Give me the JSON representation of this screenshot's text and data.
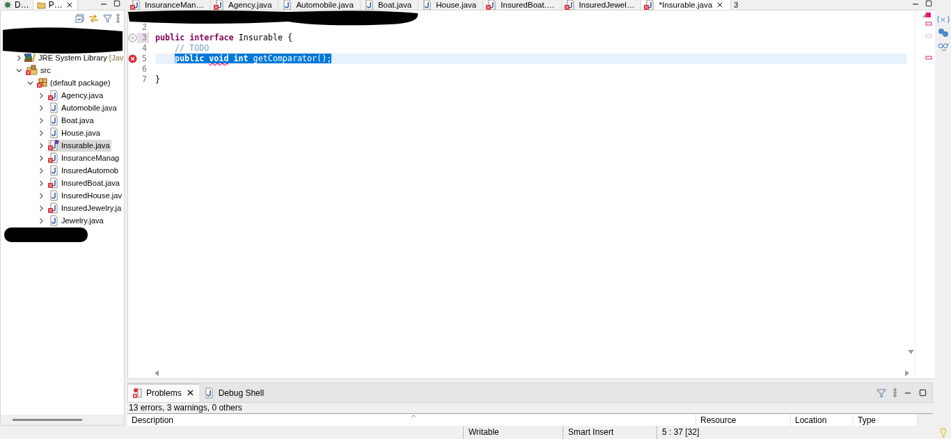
{
  "left_panel": {
    "tabs": [
      {
        "label": "D…",
        "kind": "debug",
        "selected": false
      },
      {
        "label": "P…",
        "kind": "package",
        "selected": true,
        "closable": true
      }
    ],
    "tree": [
      {
        "label": "JRE System Library",
        "suffix": "[Jav",
        "kind": "library",
        "expanded": false,
        "selected": false
      },
      {
        "label": "src",
        "kind": "folder",
        "expanded": true,
        "error": true,
        "selected": false,
        "children": [
          {
            "label": "(default package)",
            "kind": "package",
            "expanded": true,
            "error": true,
            "selected": false,
            "children": [
              {
                "label": "Agency.java",
                "kind": "class",
                "expanded": false,
                "error": true,
                "selected": false
              },
              {
                "label": "Automobile.java",
                "kind": "class",
                "expanded": false,
                "error": false,
                "selected": false
              },
              {
                "label": "Boat.java",
                "kind": "class",
                "expanded": false,
                "error": false,
                "selected": false
              },
              {
                "label": "House.java",
                "kind": "class",
                "expanded": false,
                "error": false,
                "selected": false
              },
              {
                "label": "Insurable.java",
                "kind": "interface",
                "expanded": false,
                "error": true,
                "selected": true
              },
              {
                "label": "InsuranceManag",
                "kind": "class",
                "expanded": false,
                "error": true,
                "selected": false
              },
              {
                "label": "InsuredAutomob",
                "kind": "class",
                "expanded": false,
                "error": false,
                "selected": false
              },
              {
                "label": "InsuredBoat.java",
                "kind": "class",
                "expanded": false,
                "error": true,
                "selected": false
              },
              {
                "label": "InsuredHouse.jav",
                "kind": "class",
                "expanded": false,
                "error": false,
                "selected": false
              },
              {
                "label": "InsuredJewelry.ja",
                "kind": "class",
                "expanded": false,
                "error": true,
                "selected": false
              },
              {
                "label": "Jewelry.java",
                "kind": "class",
                "expanded": false,
                "error": false,
                "selected": false
              }
            ]
          }
        ]
      }
    ]
  },
  "editor": {
    "tabs": [
      {
        "label": "InsuranceMan…",
        "error": true,
        "selected": false
      },
      {
        "label": "Agency.java",
        "error": true,
        "selected": false
      },
      {
        "label": "Automobile.java",
        "error": false,
        "selected": false
      },
      {
        "label": "Boat.java",
        "error": false,
        "selected": false
      },
      {
        "label": "House.java",
        "error": false,
        "selected": false
      },
      {
        "label": "InsuredBoat.…",
        "error": true,
        "selected": false
      },
      {
        "label": "InsuredJewel…",
        "error": true,
        "selected": false
      },
      {
        "label": "*Insurable.java",
        "error": true,
        "selected": true
      }
    ],
    "overflow_count": "3",
    "lines": [
      {
        "number": "2",
        "error_marker": false,
        "ignored_marker": false,
        "current": false,
        "changed": false
      },
      {
        "number": "3",
        "error_marker": false,
        "ignored_marker": true,
        "current": false,
        "changed": true,
        "indented": false,
        "selected": false,
        "tokens": [
          {
            "text": "public interface",
            "kind": "keyword"
          },
          {
            "text": " Insurable {",
            "kind": "plain"
          }
        ]
      },
      {
        "number": "4",
        "error_marker": false,
        "ignored_marker": false,
        "current": false,
        "changed": false,
        "indented": true,
        "selected": false,
        "tokens": [
          {
            "text": "// TODO",
            "kind": "comment"
          }
        ]
      },
      {
        "number": "5",
        "error_marker": true,
        "current": true,
        "changed": false,
        "indented": true,
        "selected": true,
        "tokens": [
          {
            "text": "public ",
            "kind": "keyword"
          },
          {
            "text": "void",
            "kind": "keyword",
            "error": true
          },
          {
            "text": " int",
            "kind": "keyword"
          },
          {
            "text": " getComparator();",
            "kind": "plain"
          }
        ]
      },
      {
        "number": "6",
        "error_marker": false,
        "ignored_marker": false,
        "current": false,
        "changed": false
      },
      {
        "number": "7",
        "error_marker": false,
        "ignored_marker": false,
        "current": false,
        "changed": false,
        "indented": false,
        "selected": false,
        "tokens": [
          {
            "text": "}",
            "kind": "plain"
          }
        ]
      }
    ]
  },
  "bottom_panel": {
    "tabs": [
      {
        "label": "Problems",
        "kind": "problems",
        "selected": true,
        "closable": true
      },
      {
        "label": "Debug Shell",
        "kind": "shell",
        "selected": false
      }
    ],
    "summary": "13 errors, 3 warnings, 0 others",
    "columns": [
      "Description",
      "Resource",
      "Location",
      "Type"
    ]
  },
  "status_bar": {
    "mode": "Writable",
    "insert": "Smart Insert",
    "position": "5 : 37 [32]"
  }
}
